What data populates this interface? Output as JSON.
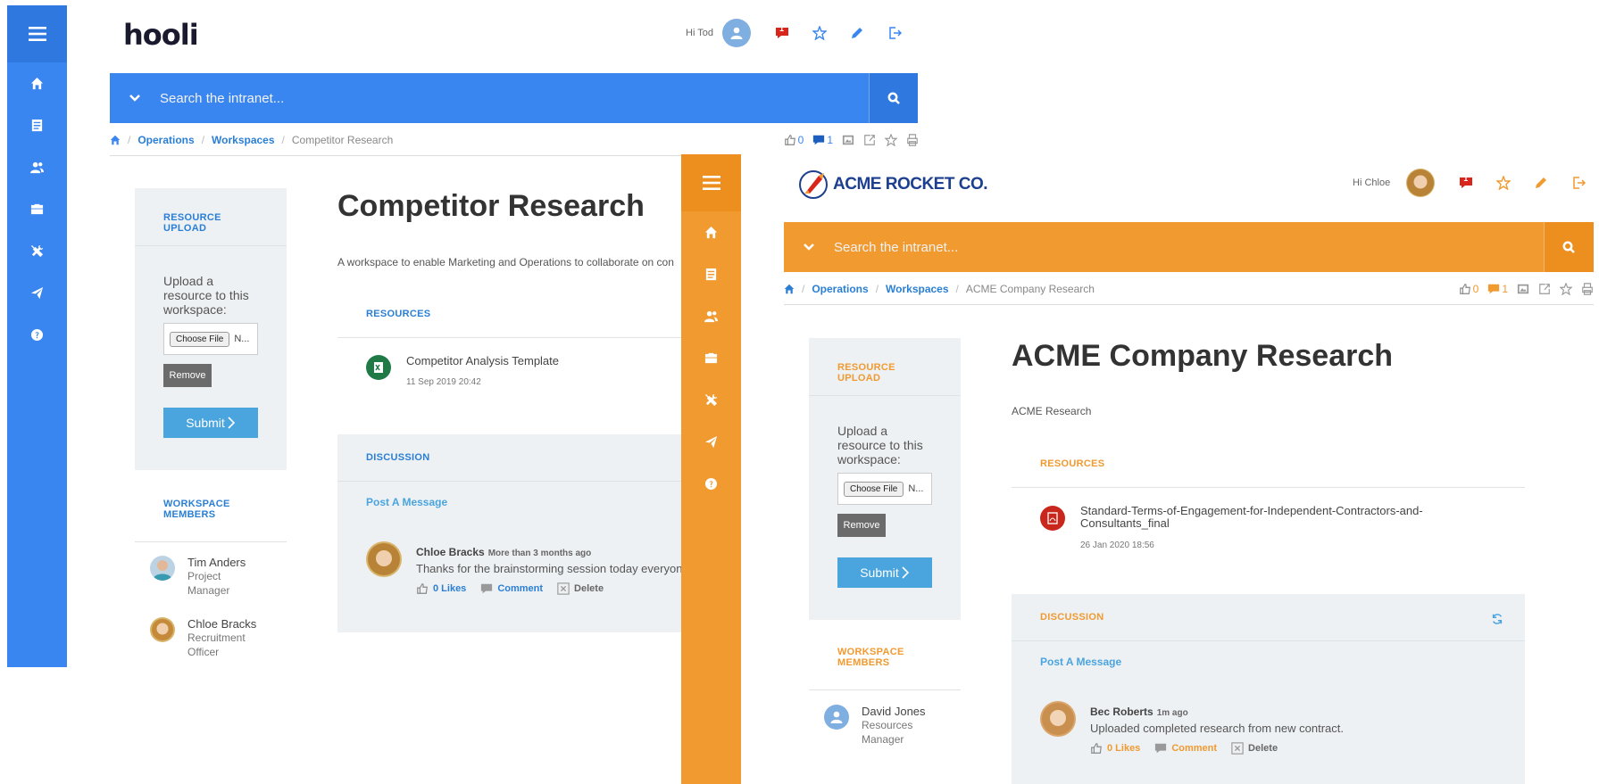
{
  "colors": {
    "hooli_blue": "#3a86f0",
    "acme_orange": "#f09a30",
    "link_blue": "#2a7fd4",
    "submit_blue": "#4aa4de"
  },
  "hooli": {
    "brand": "hooli",
    "greeting": "Hi Tod",
    "notification_count": "1",
    "search_placeholder": "Search the intranet...",
    "breadcrumb": {
      "level1": "Operations",
      "level2": "Workspaces",
      "current": "Competitor Research"
    },
    "tools": {
      "likes": "0",
      "comments": "1"
    },
    "sidebar": {
      "upload_heading": "RESOURCE UPLOAD",
      "upload_text": "Upload a resource to this workspace:",
      "choose_file": "Choose File",
      "no_file": "N...",
      "remove": "Remove",
      "submit": "Submit",
      "members_heading": "WORKSPACE MEMBERS",
      "members": [
        {
          "name": "Tim Anders",
          "role": "Project Manager"
        },
        {
          "name": "Chloe Bracks",
          "role": "Recruitment Officer"
        }
      ]
    },
    "page_title": "Competitor Research",
    "description": "A workspace to enable Marketing and Operations to collaborate on con",
    "resources_heading": "RESOURCES",
    "resource": {
      "name": "Competitor Analysis Template",
      "date": "11 Sep 2019 20:42"
    },
    "discussion_heading": "DISCUSSION",
    "post_message": "Post A Message",
    "message": {
      "author": "Chloe Bracks",
      "time": "More than 3 months ago",
      "text": "Thanks for the brainstorming session today everyone",
      "likes": "0 Likes",
      "comment": "Comment",
      "delete": "Delete"
    }
  },
  "acme": {
    "brand": "ACME ROCKET CO.",
    "greeting": "Hi Chloe",
    "notification_count": "1",
    "search_placeholder": "Search the intranet...",
    "breadcrumb": {
      "level1": "Operations",
      "level2": "Workspaces",
      "current": "ACME Company Research"
    },
    "tools": {
      "likes": "0",
      "comments": "1"
    },
    "sidebar": {
      "upload_heading": "RESOURCE UPLOAD",
      "upload_text": "Upload a resource to this workspace:",
      "choose_file": "Choose File",
      "no_file": "N...",
      "remove": "Remove",
      "submit": "Submit",
      "members_heading": "WORKSPACE MEMBERS",
      "members": [
        {
          "name": "David Jones",
          "role": "Resources Manager"
        }
      ]
    },
    "page_title": "ACME Company Research",
    "description": "ACME Research",
    "resources_heading": "RESOURCES",
    "resource": {
      "name": "Standard-Terms-of-Engagement-for-Independent-Contractors-and-Consultants_final",
      "date": "26 Jan 2020 18:56"
    },
    "discussion_heading": "DISCUSSION",
    "post_message": "Post A Message",
    "message": {
      "author": "Bec Roberts",
      "time": "1m ago",
      "text": "Uploaded completed research from new contract.",
      "likes": "0 Likes",
      "comment": "Comment",
      "delete": "Delete"
    }
  }
}
